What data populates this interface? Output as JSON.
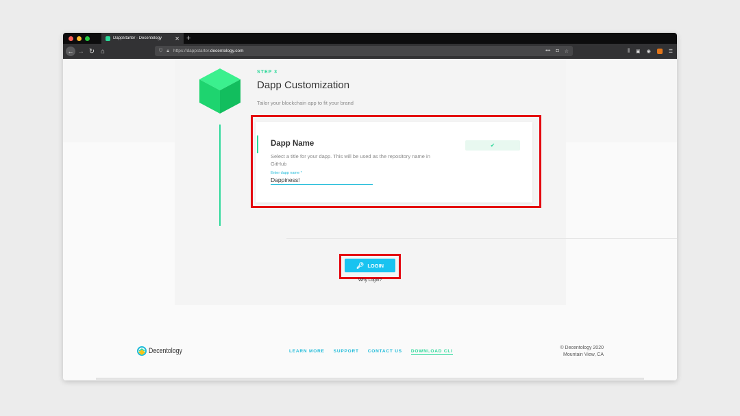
{
  "browser": {
    "tab_title": "DappStarter - Decentology",
    "tab_close": "✕",
    "new_tab": "+",
    "url_prefix": "https://dappstarter.",
    "url_domain": "decentology.com",
    "icons": [
      "back-icon",
      "forward-icon",
      "reload-icon",
      "home-icon",
      "shield-icon",
      "lock-icon",
      "more-icon",
      "pocket-icon",
      "star-icon",
      "library-icon",
      "sidebar-icon",
      "account-icon",
      "metamask-icon",
      "menu-icon"
    ]
  },
  "step": {
    "label": "STEP 3",
    "title": "Dapp Customization",
    "description": "Tailor your blockchain app to fit your brand"
  },
  "form": {
    "title": "Dapp Name",
    "description": "Select a title for your dapp. This will be used as the repository name in GitHub",
    "field_label": "Enter dapp name *",
    "field_value": "Dappiness!",
    "status_check": "✔"
  },
  "login": {
    "button_label": "LOGIN",
    "why_link": "Why Login?"
  },
  "footer": {
    "logo_text": "Decentology",
    "links": [
      "LEARN MORE",
      "SUPPORT",
      "CONTACT US",
      "DOWNLOAD CLI"
    ],
    "copyright_line1": "© Decentology 2020",
    "copyright_line2": "Mountain View, CA"
  },
  "colors": {
    "accent_green": "#2bd899",
    "accent_cyan": "#19c3f0",
    "highlight_red": "#e4060f"
  }
}
